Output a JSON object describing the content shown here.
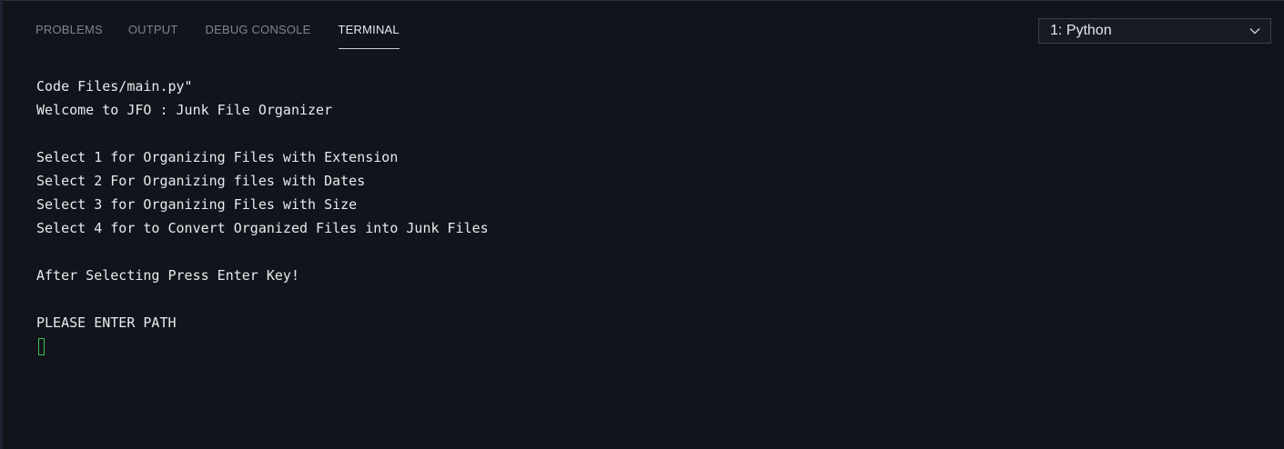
{
  "tabs": [
    {
      "label": "PROBLEMS",
      "active": false
    },
    {
      "label": "OUTPUT",
      "active": false
    },
    {
      "label": "DEBUG CONSOLE",
      "active": false
    },
    {
      "label": "TERMINAL",
      "active": true
    }
  ],
  "terminal_selector": {
    "value": "1: Python",
    "icon": "chevron-down-icon"
  },
  "terminal_output": {
    "lines": [
      "Code Files/main.py\"",
      "Welcome to JFO : Junk File Organizer",
      "",
      "Select 1 for Organizing Files with Extension",
      "Select 2 For Organizing files with Dates",
      "Select 3 for Organizing Files with Size",
      "Select 4 for to Convert Organized Files into Junk Files",
      "",
      "After Selecting Press Enter Key!",
      "",
      "PLEASE ENTER PATH"
    ]
  },
  "colors": {
    "background": "#11141b",
    "text": "#e8eaee",
    "inactive_tab": "#7c8392",
    "cursor": "#3fbf55"
  }
}
